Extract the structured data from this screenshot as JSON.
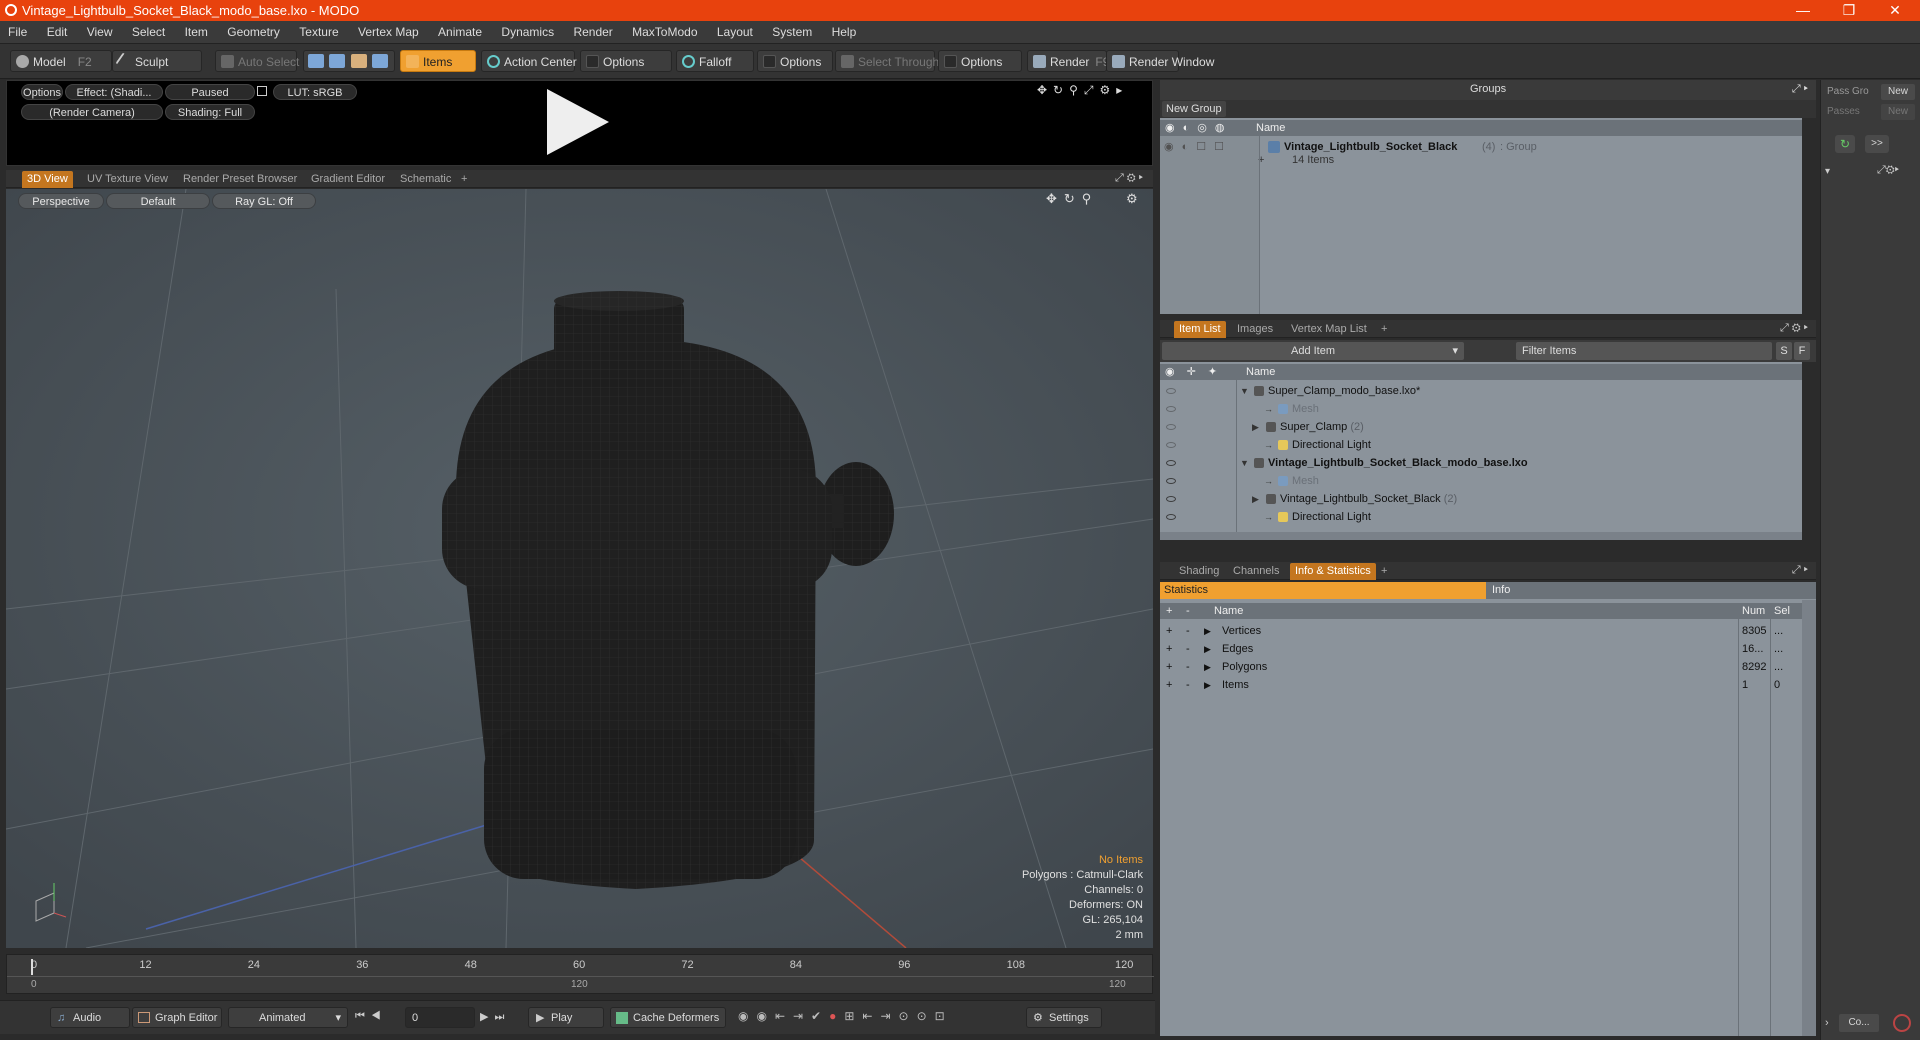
{
  "window": {
    "title": "Vintage_Lightbulb_Socket_Black_modo_base.lxo - MODO"
  },
  "menu": [
    "File",
    "Edit",
    "View",
    "Select",
    "Item",
    "Geometry",
    "Texture",
    "Vertex Map",
    "Animate",
    "Dynamics",
    "Render",
    "MaxToModo",
    "Layout",
    "System",
    "Help"
  ],
  "toolbar": {
    "model": "Model",
    "model_key": "F2",
    "sculpt": "Sculpt",
    "auto_select": "Auto Select",
    "items": "Items",
    "action_center": "Action Center",
    "options1": "Options",
    "falloff": "Falloff",
    "options2": "Options",
    "select_through": "Select Through",
    "options3": "Options",
    "render": "Render",
    "render_key": "F9",
    "render_window": "Render Window"
  },
  "preview": {
    "options": "Options",
    "effect": "Effect: (Shadi...",
    "paused": "Paused",
    "lut": "LUT: sRGB",
    "camera": "(Render Camera)",
    "shading": "Shading: Full"
  },
  "view_tabs": [
    "3D View",
    "UV Texture View",
    "Render Preset Browser",
    "Gradient Editor",
    "Schematic",
    "+"
  ],
  "viewport": {
    "perspective": "Perspective",
    "default": "Default",
    "raygl": "Ray GL: Off",
    "info_title": "No Items",
    "info_lines": [
      "Polygons : Catmull-Clark",
      "Channels: 0",
      "Deformers: ON",
      "GL: 265,104",
      "2 mm"
    ]
  },
  "timeline": {
    "ticks": [
      "0",
      "12",
      "24",
      "36",
      "48",
      "60",
      "72",
      "84",
      "96",
      "108",
      "120"
    ],
    "sub_left": "0",
    "sub_mid": "120",
    "sub_right": "120"
  },
  "bottombar": {
    "audio": "Audio",
    "graph_editor": "Graph Editor",
    "animated": "Animated",
    "frame": "0",
    "play": "Play",
    "cache": "Cache Deformers",
    "settings": "Settings"
  },
  "groups": {
    "title": "Groups",
    "new_group": "New Group",
    "col_name": "Name",
    "item_name": "Vintage_Lightbulb_Socket_Black",
    "item_count": "(4)",
    "item_type": ": Group",
    "item_sub": "14 Items"
  },
  "right_strip": {
    "pass_groups": "Pass Gro",
    "new1": "New",
    "passes": "Passes",
    "new2": "New",
    "more": ">>",
    "co": "Co..."
  },
  "item_list": {
    "tabs": [
      "Item List",
      "Images",
      "Vertex Map List",
      "+"
    ],
    "add_item": "Add Item",
    "filter": "Filter Items",
    "s": "S",
    "f": "F",
    "col_name": "Name",
    "rows": [
      {
        "label": "Super_Clamp_modo_base.lxo*",
        "count": "",
        "indent": 0,
        "bold": false,
        "dim": false
      },
      {
        "label": "Mesh",
        "count": "",
        "indent": 2,
        "bold": false,
        "dim": true
      },
      {
        "label": "Super_Clamp",
        "count": "(2)",
        "indent": 1,
        "bold": false,
        "dim": false
      },
      {
        "label": "Directional Light",
        "count": "",
        "indent": 2,
        "bold": false,
        "dim": false
      },
      {
        "label": "Vintage_Lightbulb_Socket_Black_modo_base.lxo",
        "count": "",
        "indent": 0,
        "bold": true,
        "dim": false
      },
      {
        "label": "Mesh",
        "count": "",
        "indent": 2,
        "bold": false,
        "dim": true
      },
      {
        "label": "Vintage_Lightbulb_Socket_Black",
        "count": "(2)",
        "indent": 1,
        "bold": false,
        "dim": false
      },
      {
        "label": "Directional Light",
        "count": "",
        "indent": 2,
        "bold": false,
        "dim": false
      }
    ]
  },
  "stats": {
    "tabs": [
      "Shading",
      "Channels",
      "Info & Statistics",
      "+"
    ],
    "statistics": "Statistics",
    "info": "Info",
    "col_name": "Name",
    "col_num": "Num",
    "col_sel": "Sel",
    "rows": [
      {
        "name": "Vertices",
        "num": "8305",
        "sel": "..."
      },
      {
        "name": "Edges",
        "num": "16...",
        "sel": "..."
      },
      {
        "name": "Polygons",
        "num": "8292",
        "sel": "..."
      },
      {
        "name": "Items",
        "num": "1",
        "sel": "0"
      }
    ]
  },
  "colors": {
    "titlebar": "#e8420d",
    "accent": "#f0a030",
    "panel": "#8b939b",
    "viewport": "#4b5258"
  }
}
